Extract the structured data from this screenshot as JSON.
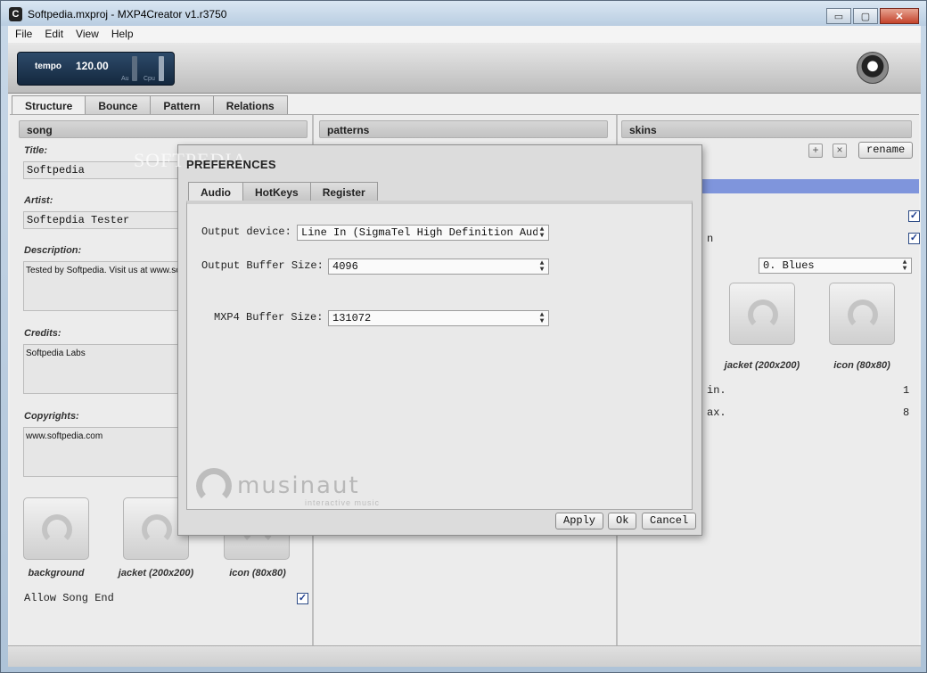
{
  "window": {
    "title": "Softpedia.mxproj  -  MXP4Creator v1.r3750",
    "app_icon_glyph": "C",
    "controls": {
      "minimize": "▭",
      "maximize": "▢",
      "close": "✕"
    }
  },
  "menu": [
    "File",
    "Edit",
    "View",
    "Help"
  ],
  "toolbar": {
    "tempo_label": "tempo",
    "tempo_value": "120.00",
    "meter_labels": [
      "Au",
      "Cpu"
    ]
  },
  "tabs": [
    {
      "label": "Structure",
      "active": true
    },
    {
      "label": "Bounce",
      "active": false
    },
    {
      "label": "Pattern",
      "active": false
    },
    {
      "label": "Relations",
      "active": false
    }
  ],
  "song": {
    "header": "song",
    "title_label": "Title:",
    "title_value": "Softpedia",
    "artist_label": "Artist:",
    "artist_value": "Softepdia Tester",
    "description_label": "Description:",
    "description_value": "Tested by Softpedia. Visit us at www.so",
    "credits_label": "Credits:",
    "credits_value": "Softpedia Labs",
    "copyrights_label": "Copyrights:",
    "copyrights_value": "www.softpedia.com",
    "thumbs": [
      "background",
      "jacket (200x200)",
      "icon (80x80)"
    ],
    "allow_song_end_label": "Allow Song End",
    "allow_song_end_checked": "✓"
  },
  "patterns": {
    "header": "patterns"
  },
  "skins": {
    "header": "skins",
    "add_symbol": "+",
    "remove_symbol": "×",
    "rename_label": "rename",
    "row_label_partial": "n",
    "genre_value": "0. Blues",
    "check1": "✓",
    "check2": "✓",
    "thumbs": [
      "jacket (200x200)",
      "icon (80x80)"
    ],
    "min_label": "in.",
    "min_value": "1",
    "max_label": "ax.",
    "max_value": "8",
    "selection_color": "#7f95dc"
  },
  "dialog": {
    "title": "PREFERENCES",
    "watermark": "SOFTPEDIA",
    "tabs": [
      {
        "label": "Audio",
        "active": true
      },
      {
        "label": "HotKeys",
        "active": false
      },
      {
        "label": "Register",
        "active": false
      }
    ],
    "output_device_label": "Output device:",
    "output_device_value": "Line In (SigmaTel High Definition Audi",
    "output_buffer_label": "Output Buffer Size:",
    "output_buffer_value": "4096",
    "mxp4_buffer_label": "MXP4 Buffer Size:",
    "mxp4_buffer_value": "131072",
    "brand_name": "musinaut",
    "brand_tagline": "interactive music",
    "apply_label": "Apply",
    "ok_label": "Ok",
    "cancel_label": "Cancel"
  }
}
